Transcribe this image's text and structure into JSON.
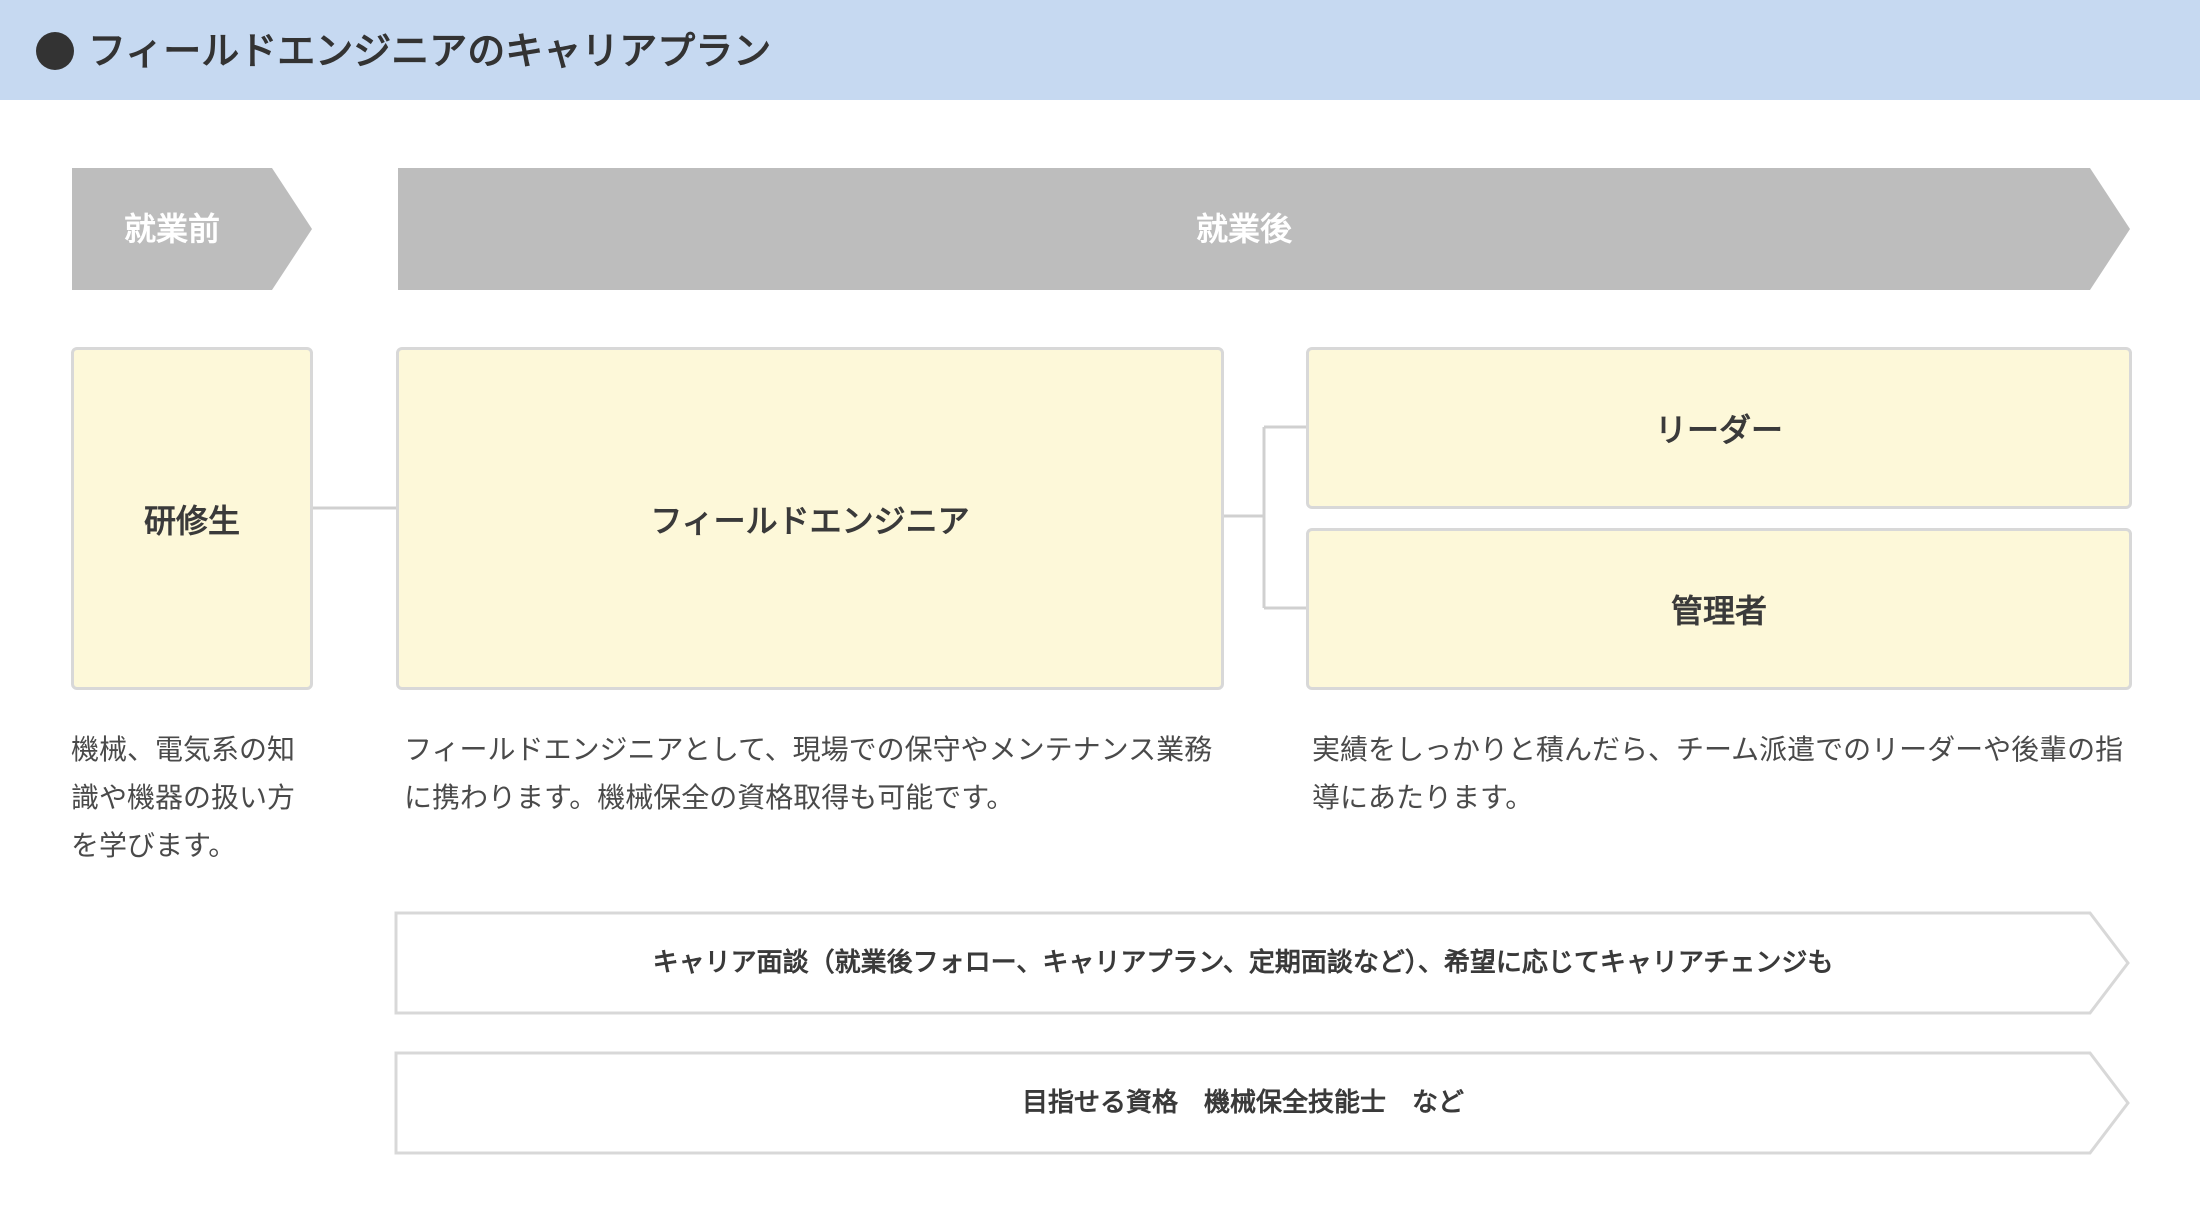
{
  "header": {
    "title": "フィールドエンジニアのキャリアプラン"
  },
  "phases": {
    "before": "就業前",
    "after": "就業後"
  },
  "nodes": {
    "trainee": "研修生",
    "field_engineer": "フィールドエンジニア",
    "leader": "リーダー",
    "manager": "管理者"
  },
  "descriptions": {
    "trainee": "機械、電気系の知識や機器の扱い方を学びます。",
    "field_engineer": "フィールドエンジニアとして、現場での保守やメンテナンス業務に携わります。機械保全の資格取得も可能です。",
    "leader_manager": "実績をしっかりと積んだら、チーム派遣でのリーダーや後輩の指導にあたります。"
  },
  "bands": {
    "career_interview": "キャリア面談（就業後フォロー、キャリアプラン、定期面談など）、希望に応じてキャリアチェンジも",
    "qualifications": "目指せる資格　機械保全技能士　など"
  },
  "colors": {
    "header_bg": "#c6d9f1",
    "phase_arrow": "#bdbdbd",
    "node_fill": "#fdf8d9",
    "node_border": "#d8d8d8",
    "connector": "#d0d0d0"
  }
}
